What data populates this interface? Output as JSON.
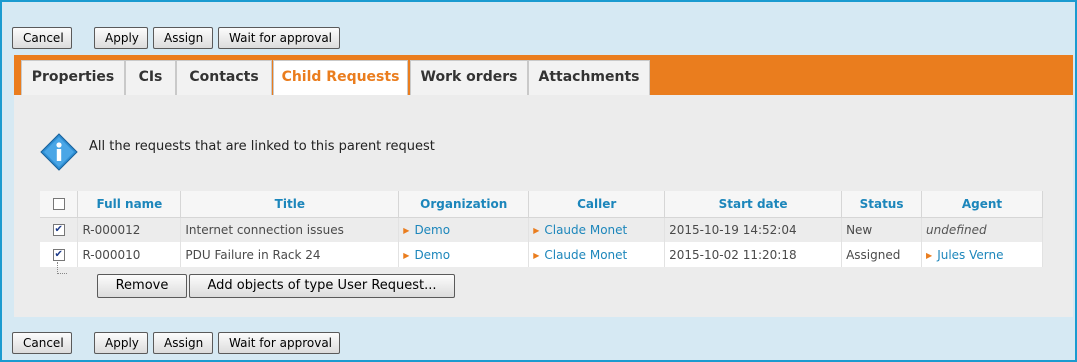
{
  "toolbar_top": {
    "cancel": "Cancel",
    "apply": "Apply",
    "assign": "Assign",
    "wait": "Wait for approval"
  },
  "tabs": [
    "Properties",
    "CIs",
    "Contacts",
    "Child Requests",
    "Work orders",
    "Attachments"
  ],
  "active_tab": "Child Requests",
  "info_message": "All the requests that are linked to this parent request",
  "table": {
    "headers": [
      "Full name",
      "Title",
      "Organization",
      "Caller",
      "Start date",
      "Status",
      "Agent"
    ],
    "rows": [
      {
        "checked": true,
        "full_name": "R-000012",
        "title": "Internet connection issues",
        "organization": "Demo",
        "caller": "Claude Monet",
        "start_date": "2015-10-19 14:52:04",
        "status": "New",
        "agent": "undefined"
      },
      {
        "checked": true,
        "full_name": "R-000010",
        "title": "PDU Failure in Rack 24",
        "organization": "Demo",
        "caller": "Claude Monet",
        "start_date": "2015-10-02 11:20:18",
        "status": "Assigned",
        "agent": "Jules Verne"
      }
    ]
  },
  "actions": {
    "remove": "Remove",
    "add": "Add objects of type User Request..."
  },
  "toolbar_bottom": {
    "cancel": "Cancel",
    "apply": "Apply",
    "assign": "Assign",
    "wait": "Wait for approval"
  },
  "colors": {
    "accent": "#ea7d1e",
    "link": "#1c86bb",
    "frame_border": "#1a9bd0",
    "background": "#d6e9f3"
  },
  "icons": {
    "info": "info-diamond-icon",
    "link_arrow": "triangle-right-icon"
  }
}
